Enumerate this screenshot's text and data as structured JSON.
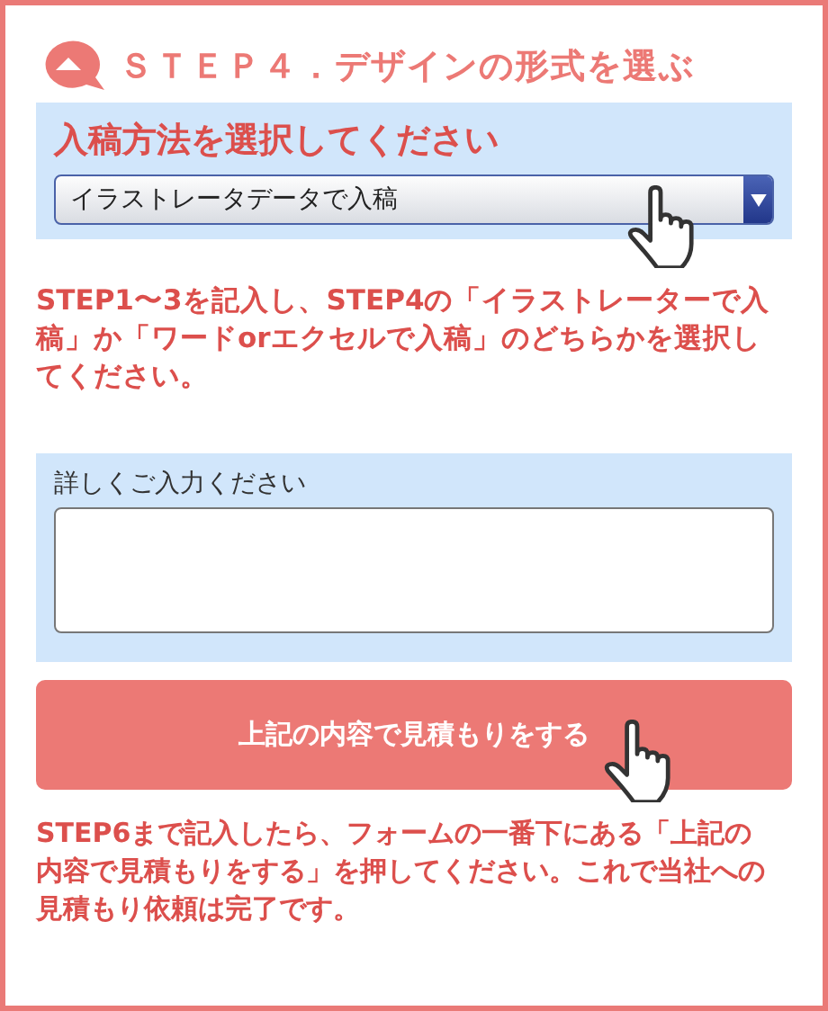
{
  "heading": "ＳＴＥＰ４．デザインの形式を選ぶ",
  "select_section": {
    "label": "入稿方法を選択してください",
    "value": "イラストレータデータで入稿"
  },
  "instruction": "STEP1〜3を記入し、STEP4の「イラストレーターで入稿」か「ワードorエクセルで入稿」のどちらかを選択してください。",
  "details_section": {
    "label": "詳しくご入力ください"
  },
  "submit_button": "上記の内容で見積もりをする",
  "footer_note": "STEP6まで記入したら、フォームの一番下にある「上記の内容で見積もりをする」を押してください。これで当社への見積もり依頼は完了です。"
}
